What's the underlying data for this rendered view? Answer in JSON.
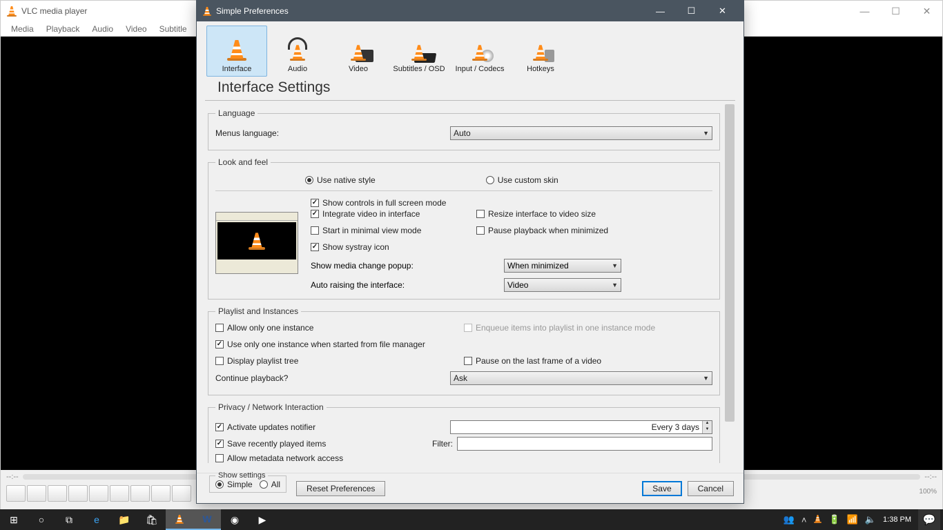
{
  "mainWindow": {
    "title": "VLC media player",
    "menus": [
      "Media",
      "Playback",
      "Audio",
      "Video",
      "Subtitle"
    ],
    "time_left": "--:--",
    "time_right": "--:--",
    "zoom": "100%"
  },
  "prefs": {
    "title": "Simple Preferences",
    "categories": [
      "Interface",
      "Audio",
      "Video",
      "Subtitles / OSD",
      "Input / Codecs",
      "Hotkeys"
    ],
    "heading": "Interface Settings",
    "language": {
      "legend": "Language",
      "menus_label": "Menus language:",
      "menus_value": "Auto"
    },
    "look": {
      "legend": "Look and feel",
      "native": "Use native style",
      "custom": "Use custom skin",
      "opts": {
        "show_controls": "Show controls in full screen mode",
        "integrate": "Integrate video in interface",
        "resize": "Resize interface to video size",
        "minimal": "Start in minimal view mode",
        "pause_min": "Pause playback when minimized",
        "systray": "Show systray icon"
      },
      "popup_label": "Show media change popup:",
      "popup_value": "When minimized",
      "autoraise_label": "Auto raising the interface:",
      "autoraise_value": "Video"
    },
    "playlist": {
      "legend": "Playlist and Instances",
      "allow_one": "Allow only one instance",
      "enqueue": "Enqueue items into playlist in one instance mode",
      "one_from_fm": "Use only one instance when started from file manager",
      "display_tree": "Display playlist tree",
      "pause_last": "Pause on the last frame of a video",
      "continue_label": "Continue playback?",
      "continue_value": "Ask"
    },
    "privacy": {
      "legend": "Privacy / Network Interaction",
      "updates": "Activate updates notifier",
      "updates_interval": "Every 3 days",
      "save_recent": "Save recently played items",
      "filter_label": "Filter:",
      "metadata": "Allow metadata network access"
    },
    "footer": {
      "show_settings": "Show settings",
      "simple": "Simple",
      "all": "All",
      "reset": "Reset Preferences",
      "save": "Save",
      "cancel": "Cancel"
    }
  },
  "taskbar": {
    "time": "1:38 PM"
  }
}
